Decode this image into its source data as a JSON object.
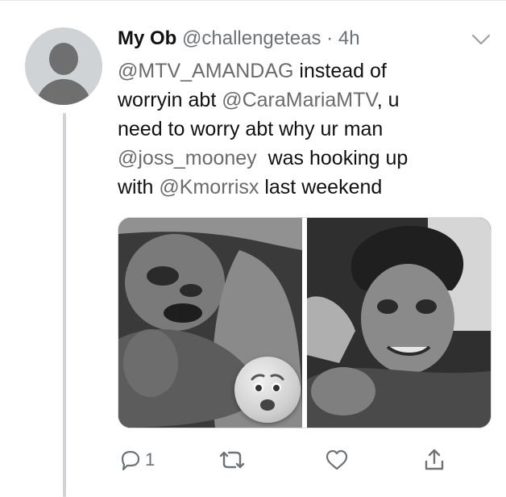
{
  "tweet": {
    "author_name": "My Ob",
    "author_handle": "@challengeteas",
    "separator": "·",
    "timestamp": "4h",
    "text_segments": {
      "l1_a": "@MTV_AMANDAG",
      "l1_b": " instead of",
      "l2_a": "worryin abt ",
      "l2_b": "@CaraMariaMTV",
      "l2_c": ", u",
      "l3": "need to worry abt why ur man",
      "l4_a": "@joss_mooney",
      "l4_b": "  was hooking up",
      "l5_a": "with ",
      "l5_b": "@Kmorrisx",
      "l5_c": " last weekend"
    },
    "media": {
      "left_overlay_emoji_icon": "anxious-face-emoji",
      "photos": [
        "photo-left",
        "photo-right"
      ]
    },
    "actions": {
      "reply_count": "1",
      "reply_icon": "reply-icon",
      "retweet_icon": "retweet-icon",
      "like_icon": "heart-icon",
      "share_icon": "share-icon"
    }
  },
  "colors": {
    "secondary_text": "#6b7278",
    "mention": "#6b6b6b",
    "thread_line": "#cfd3d7"
  }
}
